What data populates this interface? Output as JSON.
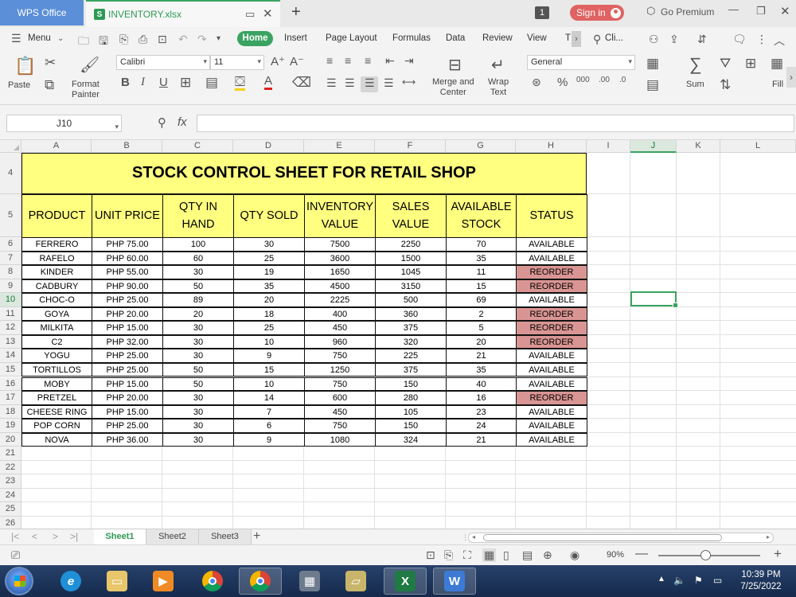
{
  "app": {
    "brand": "WPS Office",
    "file_name": "INVENTORY.xlsx",
    "file_badge": "S",
    "badge_count": "1",
    "sign_in": "Sign in",
    "premium": "Go Premium"
  },
  "menu": {
    "main": "Menu",
    "tabs": [
      "Home",
      "Insert",
      "Page Layout",
      "Formulas",
      "Data",
      "Review",
      "View",
      "T"
    ],
    "search": "Cli..."
  },
  "ribbon": {
    "paste": "Paste",
    "format_painter": "Format\nPainter",
    "font_name": "Calibri",
    "font_size": "11",
    "merge_center": "Merge and\nCenter",
    "wrap_text": "Wrap\nText",
    "number_format": "General",
    "sum": "Sum",
    "fill": "Fill"
  },
  "formula_bar": {
    "cell_ref": "J10",
    "fx": "fx",
    "value": ""
  },
  "grid": {
    "columns": [
      "A",
      "B",
      "C",
      "D",
      "E",
      "F",
      "G",
      "H",
      "I",
      "J",
      "K",
      "L"
    ],
    "active_column": "J",
    "active_row": "10",
    "row_labels": [
      "4",
      "5",
      "6",
      "7",
      "8",
      "9",
      "10",
      "11",
      "12",
      "13",
      "14",
      "15",
      "16",
      "17",
      "18",
      "19",
      "20",
      "21",
      "22",
      "23",
      "24",
      "25",
      "26"
    ]
  },
  "sheet": {
    "title": "STOCK CONTROL SHEET FOR RETAIL SHOP",
    "headers": [
      "PRODUCT",
      "UNIT PRICE",
      "QTY IN\nHAND",
      "QTY SOLD",
      "INVENTORY\nVALUE",
      "SALES\nVALUE",
      "AVAILABLE\nSTOCK",
      "STATUS"
    ],
    "rows": [
      [
        "FERRERO",
        "PHP 75.00",
        "100",
        "30",
        "7500",
        "2250",
        "70",
        "AVAILABLE"
      ],
      [
        "RAFELO",
        "PHP 60.00",
        "60",
        "25",
        "3600",
        "1500",
        "35",
        "AVAILABLE"
      ],
      [
        "KINDER",
        "PHP 55.00",
        "30",
        "19",
        "1650",
        "1045",
        "11",
        "REORDER"
      ],
      [
        "CADBURY",
        "PHP 90.00",
        "50",
        "35",
        "4500",
        "3150",
        "15",
        "REORDER"
      ],
      [
        "CHOC-O",
        "PHP 25.00",
        "89",
        "20",
        "2225",
        "500",
        "69",
        "AVAILABLE"
      ],
      [
        "GOYA",
        "PHP 20.00",
        "20",
        "18",
        "400",
        "360",
        "2",
        "REORDER"
      ],
      [
        "MILKITA",
        "PHP 15.00",
        "30",
        "25",
        "450",
        "375",
        "5",
        "REORDER"
      ],
      [
        "C2",
        "PHP 32.00",
        "30",
        "10",
        "960",
        "320",
        "20",
        "REORDER"
      ],
      [
        "YOGU",
        "PHP 25.00",
        "30",
        "9",
        "750",
        "225",
        "21",
        "AVAILABLE"
      ],
      [
        "TORTILLOS",
        "PHP 25.00",
        "50",
        "15",
        "1250",
        "375",
        "35",
        "AVAILABLE"
      ],
      [
        "MOBY",
        "PHP 15.00",
        "50",
        "10",
        "750",
        "150",
        "40",
        "AVAILABLE"
      ],
      [
        "PRETZEL",
        "PHP 20.00",
        "30",
        "14",
        "600",
        "280",
        "16",
        "REORDER"
      ],
      [
        "CHEESE RING",
        "PHP 15.00",
        "30",
        "7",
        "450",
        "105",
        "23",
        "AVAILABLE"
      ],
      [
        "POP CORN",
        "PHP 25.00",
        "30",
        "6",
        "750",
        "150",
        "24",
        "AVAILABLE"
      ],
      [
        "NOVA",
        "PHP 36.00",
        "30",
        "9",
        "1080",
        "324",
        "21",
        "AVAILABLE"
      ]
    ],
    "title_color": "#ffff80",
    "reorder_color": "#d99593"
  },
  "sheet_tabs": [
    "Sheet1",
    "Sheet2",
    "Sheet3"
  ],
  "active_sheet": "Sheet1",
  "status": {
    "zoom": "90%"
  },
  "taskbar": {
    "apps": [
      "internet-explorer",
      "file-explorer",
      "media-player",
      "chrome",
      "chrome-profile",
      "calculator",
      "folder",
      "excel",
      "wps"
    ],
    "time": "10:39 PM",
    "date": "7/25/2022"
  },
  "colors": {
    "accent": "#3aa361",
    "brand_tab": "#5b8fd8",
    "sign_in": "#e06262"
  }
}
